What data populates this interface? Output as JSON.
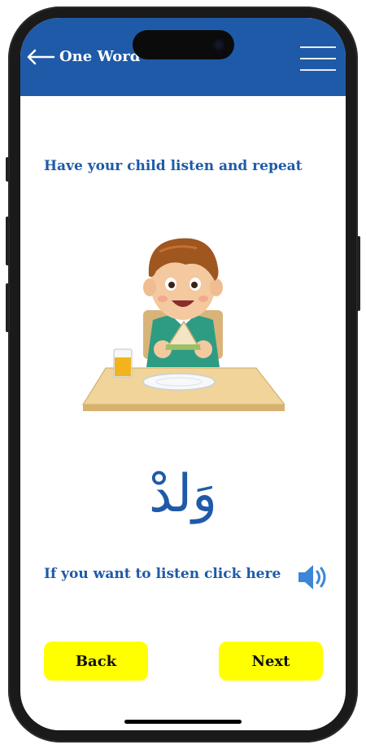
{
  "header": {
    "title": "One Word",
    "back_icon": "arrow-left-icon",
    "menu_icon": "hamburger-menu-icon",
    "background_color": "#1f5aa8"
  },
  "lesson": {
    "instruction": "Have your child listen and repeat",
    "image_subject": "boy-eating-sandwich-illustration",
    "word": "وَلدْ",
    "listen_prompt": "If you want to listen click here",
    "speaker_icon": "speaker-volume-icon"
  },
  "nav": {
    "back_label": "Back",
    "next_label": "Next",
    "button_color": "#ffff00"
  },
  "colors": {
    "accent": "#1f5aa8",
    "text_dark": "#111111"
  }
}
